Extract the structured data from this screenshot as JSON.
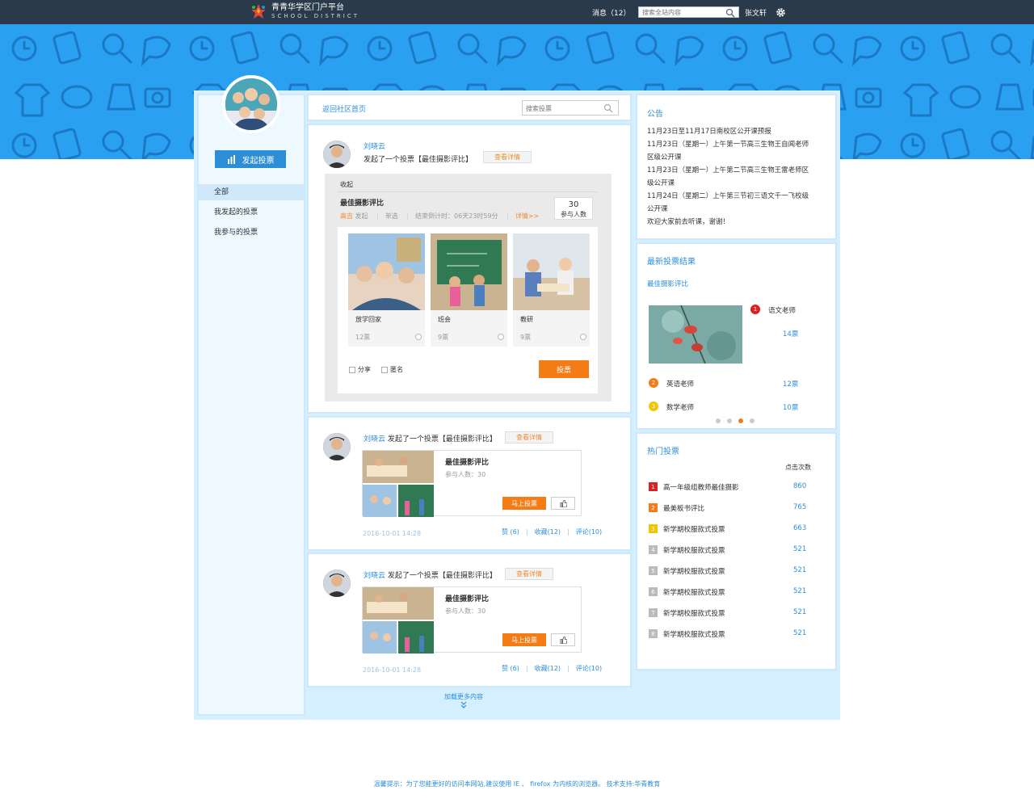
{
  "topbar": {
    "logo_title": "青青华学区门户平台",
    "logo_sub": "SCHOOL  DISTRICT",
    "messages": "消息（12）",
    "search_placeholder": "搜索全站内容",
    "user": "张文轩"
  },
  "sidebar": {
    "start_vote": "发起投票",
    "items": [
      "全部",
      "我发起的投票",
      "我参与的投票"
    ]
  },
  "midtop": {
    "back": "返回社区首页",
    "search_placeholder": "搜索投票"
  },
  "card1": {
    "user": "刘晓云",
    "action": "发起了一个投票【最佳摄影评比】",
    "detail": "查看详情",
    "collapse": "收起",
    "vote_title": "最佳摄影评比",
    "starter": "高吉",
    "started": "发起",
    "mode": "单选",
    "countdown": "结束倒计时：06天23时59分",
    "details_link": "详情>>",
    "count_num": "30",
    "count_label": "参与人数",
    "options": [
      {
        "name": "放学回家",
        "votes": "12票"
      },
      {
        "name": "班会",
        "votes": "9票"
      },
      {
        "name": "教研",
        "votes": "9票"
      }
    ],
    "share": "分享",
    "anon": "匿名",
    "vote_btn": "投票"
  },
  "feeds": [
    {
      "user": "刘晓云",
      "action": "发起了一个投票【最佳摄影评比】",
      "detail": "查看详情",
      "title": "最佳摄影评比",
      "participants": "参与人数：30",
      "go": "马上投票",
      "time": "2016-10-01 14:28",
      "likes": "赞 (6)",
      "fav": "收藏(12)",
      "comments": "评论(10)"
    },
    {
      "user": "刘晓云",
      "action": "发起了一个投票【最佳摄影评比】",
      "detail": "查看详情",
      "title": "最佳摄影评比",
      "participants": "参与人数：30",
      "go": "马上投票",
      "time": "2016-10-01 14:28",
      "likes": "赞 (6)",
      "fav": "收藏(12)",
      "comments": "评论(10)"
    }
  ],
  "load_more": "加载更多内容",
  "notice": {
    "title": "公告",
    "lines": [
      "11月23日至11月17日南校区公开课预报",
      "11月23日（星期一）上午第一节高三生物王自闻老师",
      "区级公开课",
      "11月23日（星期一）上午第二节高三生物王雷老师区",
      "级公开课",
      "11月24日（星期二）上午第三节初三语文千一飞校级",
      "公开课",
      "欢迎大家前去听课，谢谢！"
    ]
  },
  "results": {
    "title": "最新投票结果",
    "subtitle": "最佳摄影评比",
    "items": [
      {
        "rank": "1",
        "name": "语文老师",
        "votes": "14票",
        "color": "#e02020"
      },
      {
        "rank": "2",
        "name": "英语老师",
        "votes": "12票",
        "color": "#f37c16"
      },
      {
        "rank": "3",
        "name": "数学老师",
        "votes": "10票",
        "color": "#f5c400"
      }
    ]
  },
  "hot": {
    "title": "热门投票",
    "col": "点击次数",
    "items": [
      {
        "rank": "1",
        "name": "高一年级组教师最佳摄影",
        "count": "860",
        "color": "#e02020"
      },
      {
        "rank": "2",
        "name": "最美板书评比",
        "count": "765",
        "color": "#f37c16"
      },
      {
        "rank": "3",
        "name": "新学期校服款式投票",
        "count": "663",
        "color": "#f5c400"
      },
      {
        "rank": "4",
        "name": "新学期校服款式投票",
        "count": "521",
        "color": "#bbbbbb"
      },
      {
        "rank": "5",
        "name": "新学期校服款式投票",
        "count": "521",
        "color": "#bbbbbb"
      },
      {
        "rank": "6",
        "name": "新学期校服款式投票",
        "count": "521",
        "color": "#bbbbbb"
      },
      {
        "rank": "7",
        "name": "新学期校服款式投票",
        "count": "521",
        "color": "#bbbbbb"
      },
      {
        "rank": "8",
        "name": "新学期校服款式投票",
        "count": "521",
        "color": "#bbbbbb"
      }
    ]
  },
  "footer": "温馨提示：为了您能更好的访问本网站,建议使用 IE 、 firefox 为内核的浏览器。 技术支持:华青教育"
}
